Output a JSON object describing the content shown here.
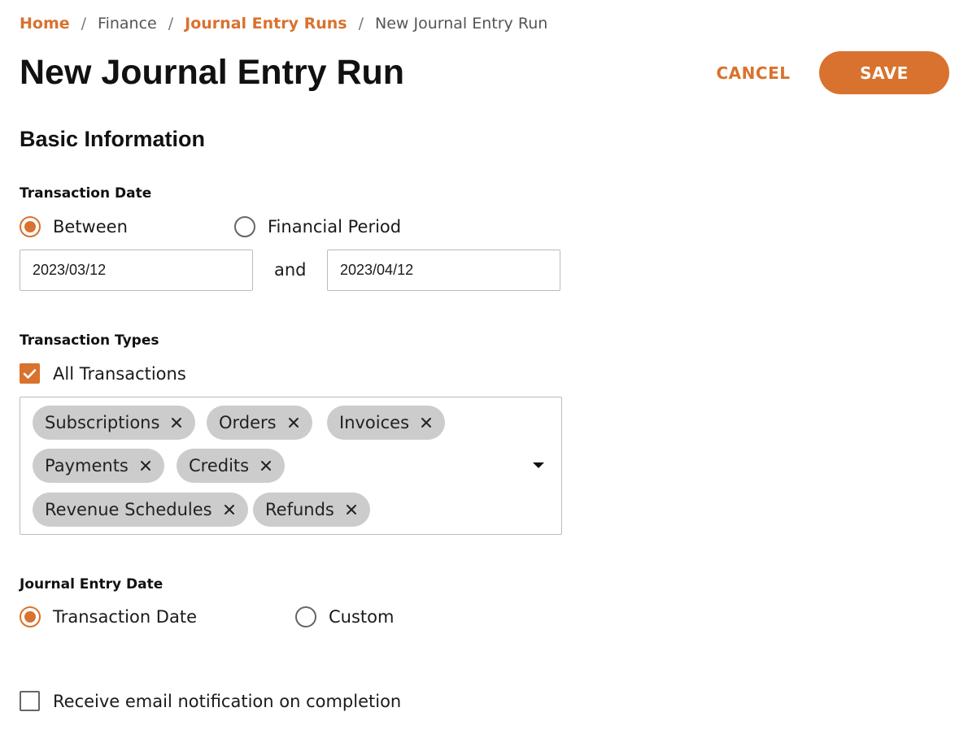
{
  "breadcrumb": {
    "home": "Home",
    "finance": "Finance",
    "journal_entry_runs": "Journal Entry Runs",
    "current": "New Journal Entry Run",
    "separator": "/"
  },
  "header": {
    "title": "New Journal Entry Run",
    "cancel_label": "CANCEL",
    "save_label": "SAVE"
  },
  "section": {
    "title": "Basic Information"
  },
  "transaction_date": {
    "label": "Transaction Date",
    "options": [
      {
        "label": "Between",
        "selected": true
      },
      {
        "label": "Financial Period",
        "selected": false
      }
    ],
    "start_value": "2023/03/12",
    "and_label": "and",
    "end_value": "2023/04/12"
  },
  "transaction_types": {
    "label": "Transaction Types",
    "all_label": "All Transactions",
    "all_checked": true,
    "chips": [
      "Subscriptions",
      "Orders",
      "Invoices",
      "Payments",
      "Credits",
      "Revenue Schedules",
      "Refunds"
    ],
    "remove_icon": "close-icon",
    "dropdown_icon": "caret-down-icon"
  },
  "journal_entry_date": {
    "label": "Journal Entry Date",
    "options": [
      {
        "label": "Transaction Date",
        "selected": true
      },
      {
        "label": "Custom",
        "selected": false
      }
    ]
  },
  "notification": {
    "label": "Receive email notification on completion",
    "checked": false
  },
  "colors": {
    "accent": "#d9722e",
    "chip_bg": "#cccccc",
    "border": "#bbbbbb"
  }
}
